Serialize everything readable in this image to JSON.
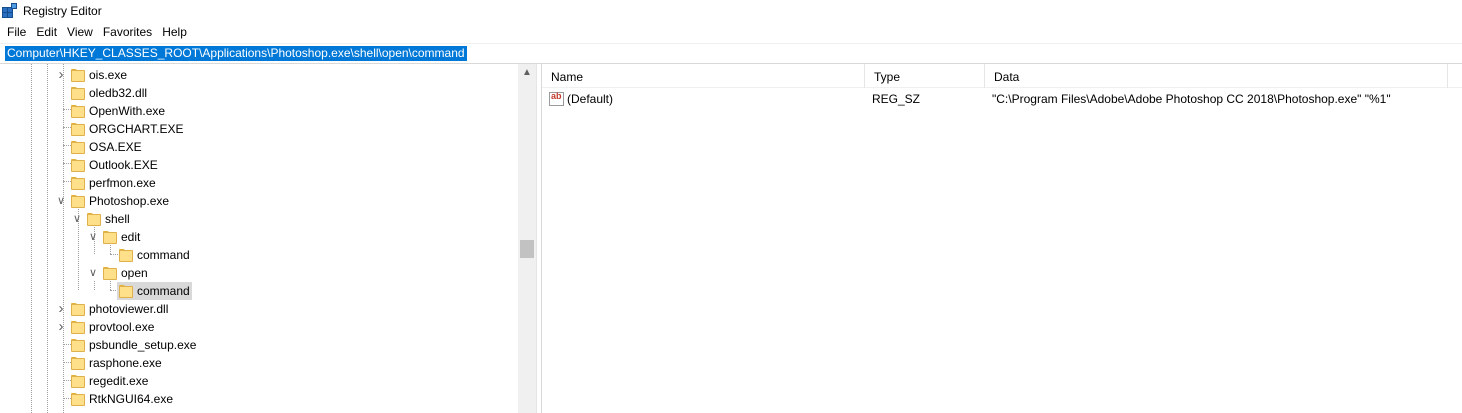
{
  "window": {
    "title": "Registry Editor"
  },
  "menu": [
    "File",
    "Edit",
    "View",
    "Favorites",
    "Help"
  ],
  "address": {
    "value": "Computer\\HKEY_CLASSES_ROOT\\Applications\\Photoshop.exe\\shell\\open\\command"
  },
  "tree": {
    "items": [
      {
        "label": "ois.exe",
        "expander": "collapsed"
      },
      {
        "label": "oledb32.dll",
        "expander": "none"
      },
      {
        "label": "OpenWith.exe",
        "expander": "none"
      },
      {
        "label": "ORGCHART.EXE",
        "expander": "none"
      },
      {
        "label": "OSA.EXE",
        "expander": "none"
      },
      {
        "label": "Outlook.EXE",
        "expander": "none"
      },
      {
        "label": "perfmon.exe",
        "expander": "none"
      },
      {
        "label": "Photoshop.exe",
        "expander": "expanded"
      },
      {
        "label": "shell",
        "expander": "expanded"
      },
      {
        "label": "edit",
        "expander": "expanded"
      },
      {
        "label": "command",
        "expander": "none"
      },
      {
        "label": "open",
        "expander": "expanded"
      },
      {
        "label": "command",
        "expander": "none",
        "selected": true
      },
      {
        "label": "photoviewer.dll",
        "expander": "collapsed"
      },
      {
        "label": "provtool.exe",
        "expander": "collapsed"
      },
      {
        "label": "psbundle_setup.exe",
        "expander": "none"
      },
      {
        "label": "rasphone.exe",
        "expander": "none"
      },
      {
        "label": "regedit.exe",
        "expander": "none"
      },
      {
        "label": "RtkNGUI64.exe",
        "expander": "none"
      }
    ]
  },
  "list": {
    "columns": [
      "Name",
      "Type",
      "Data"
    ],
    "rows": [
      {
        "name": "(Default)",
        "type": "REG_SZ",
        "data": "\"C:\\Program Files\\Adobe\\Adobe Photoshop CC 2018\\Photoshop.exe\" \"%1\"",
        "icon": "string-value-icon"
      }
    ]
  },
  "colors": {
    "selection": "#0078d7",
    "folder": "#ffe08a",
    "tree_selected": "#d9d9d9"
  }
}
